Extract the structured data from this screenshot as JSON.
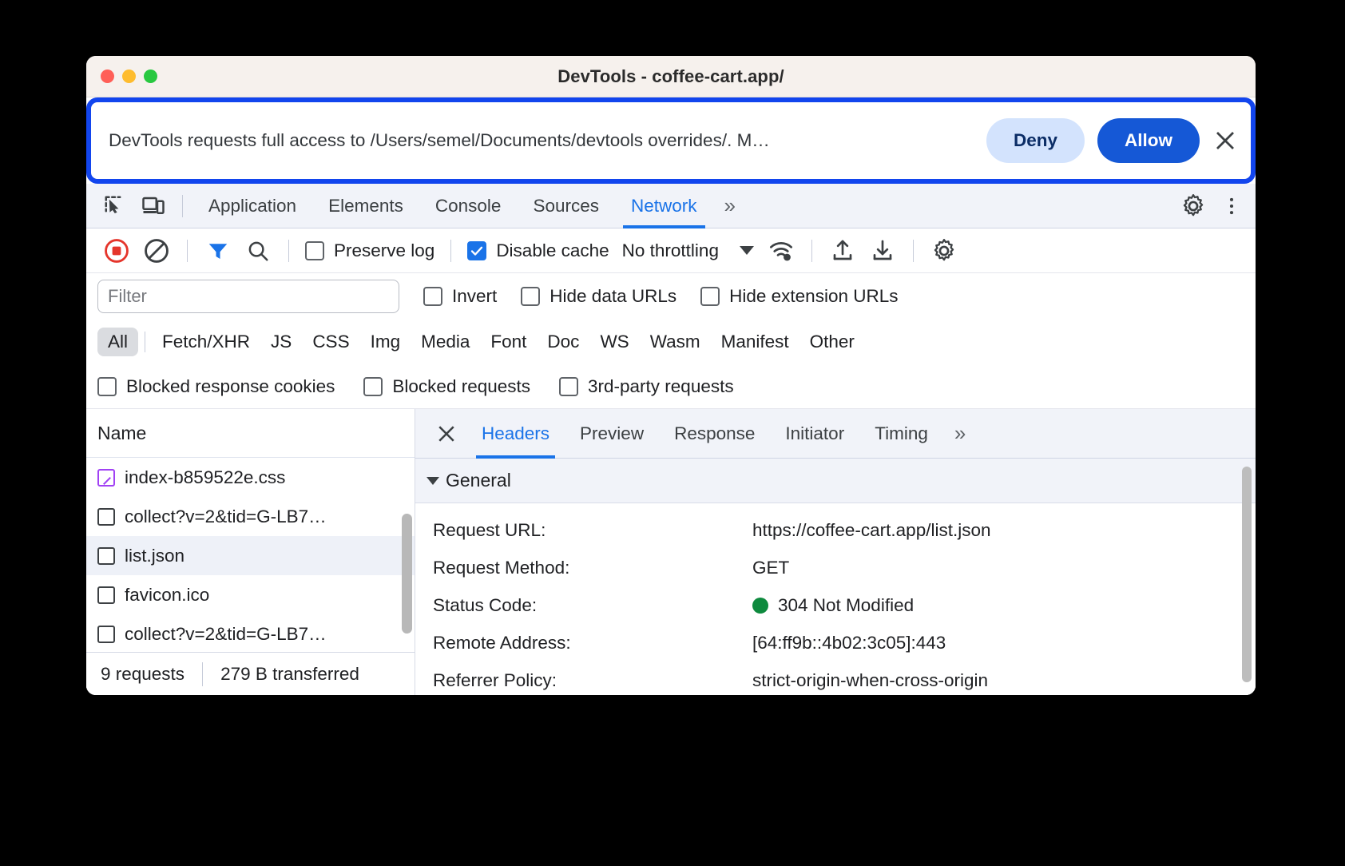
{
  "window": {
    "title": "DevTools - coffee-cart.app/",
    "traffic_lights": [
      "close",
      "minimize",
      "maximize"
    ]
  },
  "permission_bar": {
    "message": "DevTools requests full access to /Users/semel/Documents/devtools overrides/. M…",
    "deny_label": "Deny",
    "allow_label": "Allow",
    "close_icon": "close-icon",
    "highlight_color": "#1245ee",
    "allow_color": "#1558d6",
    "deny_color": "#d3e3fd"
  },
  "tabstrip": {
    "inspect_icon": "inspect-element-icon",
    "device_icon": "device-toolbar-icon",
    "tabs": [
      {
        "label": "Application",
        "active": false
      },
      {
        "label": "Elements",
        "active": false
      },
      {
        "label": "Console",
        "active": false
      },
      {
        "label": "Sources",
        "active": false
      },
      {
        "label": "Network",
        "active": true
      }
    ],
    "more_tabs": "»",
    "settings_icon": "gear-icon",
    "more_icon": "kebab-menu-icon",
    "accent_color": "#1a73e8"
  },
  "network_toolbar": {
    "record_icon": "record-stop-icon",
    "clear_icon": "clear-icon",
    "filter_icon": "filter-icon",
    "search_icon": "search-icon",
    "preserve_log": {
      "label": "Preserve log",
      "checked": false
    },
    "disable_cache": {
      "label": "Disable cache",
      "checked": true
    },
    "throttling": {
      "value": "No throttling",
      "caret": "chevron-down-icon"
    },
    "network_conditions_icon": "wifi-settings-icon",
    "import_icon": "import-har-icon",
    "export_icon": "export-har-icon",
    "settings_icon": "gear-icon"
  },
  "filter_row": {
    "filter_placeholder": "Filter",
    "filter_value": "",
    "invert": {
      "label": "Invert",
      "checked": false
    },
    "hide_data_urls": {
      "label": "Hide data URLs",
      "checked": false
    },
    "hide_extension_urls": {
      "label": "Hide extension URLs",
      "checked": false
    }
  },
  "type_filters": {
    "all": "All",
    "types": [
      "Fetch/XHR",
      "JS",
      "CSS",
      "Img",
      "Media",
      "Font",
      "Doc",
      "WS",
      "Wasm",
      "Manifest",
      "Other"
    ],
    "selected": "All"
  },
  "blocked_row": {
    "blocked_response_cookies": {
      "label": "Blocked response cookies",
      "checked": false
    },
    "blocked_requests": {
      "label": "Blocked requests",
      "checked": false
    },
    "third_party_requests": {
      "label": "3rd-party requests",
      "checked": false
    }
  },
  "request_list": {
    "column_header": "Name",
    "rows": [
      {
        "name": "index-b859522e.css",
        "icon": "stylesheet-icon",
        "selected": false,
        "alt": false
      },
      {
        "name": "collect?v=2&tid=G-LB7…",
        "icon": "document-icon",
        "selected": false,
        "alt": false
      },
      {
        "name": "list.json",
        "icon": "document-icon",
        "selected": true,
        "alt": true
      },
      {
        "name": "favicon.ico",
        "icon": "document-icon",
        "selected": false,
        "alt": false
      },
      {
        "name": "collect?v=2&tid=G-LB7…",
        "icon": "document-icon",
        "selected": false,
        "alt": false
      }
    ],
    "status_requests": "9 requests",
    "status_transferred": "279 B transferred"
  },
  "detail_panel": {
    "close_icon": "close-icon",
    "tabs": [
      {
        "label": "Headers",
        "active": true
      },
      {
        "label": "Preview",
        "active": false
      },
      {
        "label": "Response",
        "active": false
      },
      {
        "label": "Initiator",
        "active": false
      },
      {
        "label": "Timing",
        "active": false
      }
    ],
    "more_tabs": "»",
    "section_title": "General",
    "rows": [
      {
        "key": "Request URL:",
        "value": "https://coffee-cart.app/list.json",
        "dot": false
      },
      {
        "key": "Request Method:",
        "value": "GET",
        "dot": false
      },
      {
        "key": "Status Code:",
        "value": "304 Not Modified",
        "dot": true,
        "dot_color": "#0e8a3e"
      },
      {
        "key": "Remote Address:",
        "value": "[64:ff9b::4b02:3c05]:443",
        "dot": false
      },
      {
        "key": "Referrer Policy:",
        "value": "strict-origin-when-cross-origin",
        "dot": false
      }
    ]
  }
}
